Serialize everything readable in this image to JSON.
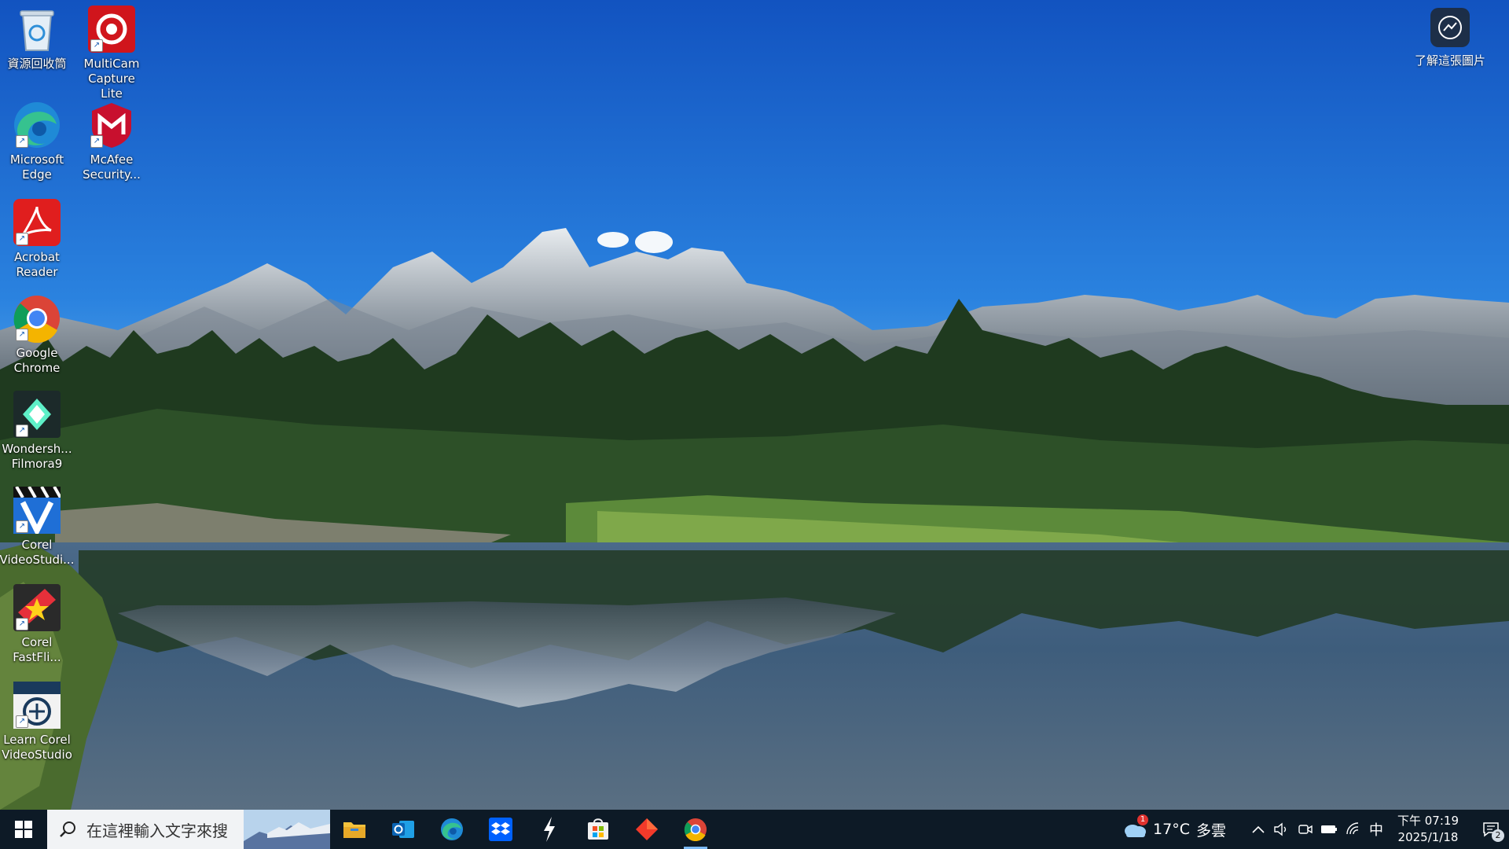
{
  "desktop": {
    "icons": [
      {
        "label": "資源回收筒",
        "icon": "recycle-bin-icon"
      },
      {
        "label": "MultiCam\nCapture Lite",
        "icon": "multicam-icon"
      },
      {
        "label": "Microsoft\nEdge",
        "icon": "edge-icon"
      },
      {
        "label": "McAfee\nSecurity...",
        "icon": "mcafee-icon"
      },
      {
        "label": "Acrobat\nReader",
        "icon": "acrobat-icon"
      },
      {
        "label": "Google\nChrome",
        "icon": "chrome-icon"
      },
      {
        "label": "Wondersh...\nFilmora9",
        "icon": "filmora-icon"
      },
      {
        "label": "Corel\nVideoStudi...",
        "icon": "videostudio-icon"
      },
      {
        "label": "Corel\nFastFli...",
        "icon": "fastflick-icon"
      },
      {
        "label": "Learn Corel\nVideoStudio",
        "icon": "learn-videostudio-icon"
      }
    ],
    "learn_about_picture": {
      "label": "了解這張圖片",
      "icon": "camera-info-icon"
    }
  },
  "taskbar": {
    "search_placeholder": "在這裡輸入文字來搜",
    "pinned": [
      {
        "name": "file-explorer",
        "icon": "folder-icon"
      },
      {
        "name": "outlook",
        "icon": "outlook-icon"
      },
      {
        "name": "edge",
        "icon": "edge-icon"
      },
      {
        "name": "dropbox",
        "icon": "dropbox-icon"
      },
      {
        "name": "app-lightning",
        "icon": "lightning-icon"
      },
      {
        "name": "microsoft-store",
        "icon": "store-icon"
      },
      {
        "name": "app-diamond",
        "icon": "diamond-icon"
      },
      {
        "name": "chrome",
        "icon": "chrome-icon",
        "active": true
      }
    ],
    "weather": {
      "temp": "17°C",
      "condition": "多雲",
      "badge": "1"
    },
    "ime": "中",
    "clock": {
      "time": "下午 07:19",
      "date": "2025/1/18"
    },
    "notification_count": "2"
  },
  "colors": {
    "taskbar_bg": "#0d1a26",
    "sky_top": "#1560c8",
    "sky_bottom": "#5aa7e8"
  }
}
